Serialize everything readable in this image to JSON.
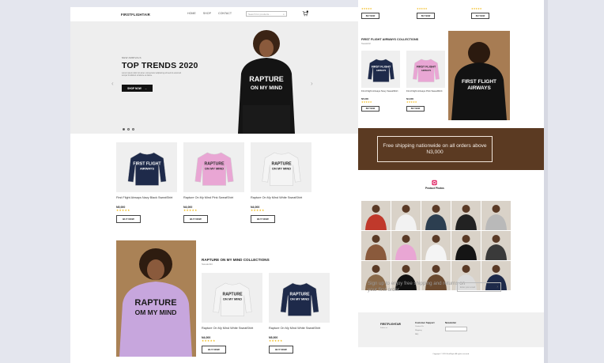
{
  "header": {
    "logo": "FIRSTFLIGHTAIR",
    "nav": [
      "HOME",
      "SHOP",
      "CONTACT"
    ],
    "search_placeholder": "Search for products..."
  },
  "hero": {
    "eyebrow": "NEW ARRIVALS",
    "title": "TOP TRENDS 2020",
    "description": "Lorem ipsum dolor sit amet, consectetur adipiscing elit sed do eiusmod tempor incididunt ut labore et dolore.",
    "button_label": "SHOP NOW",
    "print_line1": "RAPTURE",
    "print_line2": "ON MY MIND"
  },
  "products": [
    {
      "name": "First Flight Airways Navy Black SweatShirt",
      "price": "N5,000",
      "stars": "★★★★★",
      "button": "BUY NOW",
      "color": "#1e2a4a",
      "print": "FIRST FLIGHT\nAIRWAYS",
      "ink": "#ffffff"
    },
    {
      "name": "Rapture On My Mind Pink SweatShirt",
      "price": "N4,000",
      "stars": "★★★★★",
      "button": "BUY NOW",
      "color": "#e9a6d4",
      "print": "RAPTURE\nON MY MIND",
      "ink": "#2a2a2a"
    },
    {
      "name": "Rapture On My Mind White SweatShirt",
      "price": "N4,000",
      "stars": "★★★★★",
      "button": "BUY NOW",
      "color": "#f4f4f4",
      "print": "RAPTURE\nON MY MIND",
      "ink": "#222222"
    }
  ],
  "rapture_collection": {
    "title": "RAPTURE ON MY MIND COLLECTIONS",
    "subtitle": "Sweatshirt",
    "model_print_line1": "RAPTURE",
    "model_print_line2": "OM MY MIND",
    "items": [
      {
        "name": "Rapture On My Mind White SweatShirt",
        "price": "N4,000",
        "stars": "★★★★★",
        "button": "BUY NOW",
        "color": "#f4f4f4",
        "print": "RAPTURE\nON MY MIND",
        "ink": "#222222"
      },
      {
        "name": "Rapture On My Mind White SweatShirt",
        "price": "N5,000",
        "stars": "★★★★★",
        "button": "BUY NOW",
        "color": "#1e2a4a",
        "print": "RAPTURE\nON MY MIND",
        "ink": "#ffffff"
      }
    ]
  },
  "right_top": {
    "stars": "★★★★★",
    "button": "BUY NOW"
  },
  "airways_collection": {
    "title": "FIRST FLIGHT AIRWAYS COLLECTIONS",
    "subtitle": "Sweatshirt",
    "model_print_line1": "FIRST FLIGHT",
    "model_print_line2": "AIRWAYS",
    "items": [
      {
        "name": "First Flight Airways Navy SweatShirt",
        "price": "N5,000",
        "stars": "★★★★★",
        "button": "BUY NOW",
        "color": "#1e2a4a",
        "print": "FIRST FLIGHT\nAIRWAYS",
        "ink": "#ffffff"
      },
      {
        "name": "First Flight Airways Pink SweatShirt",
        "price": "N4,000",
        "stars": "★★★★★",
        "button": "BUY NOW",
        "color": "#e9a6d4",
        "print": "FIRST FLIGHT\nAIRWAYS",
        "ink": "#2a2a2a"
      }
    ]
  },
  "banner": {
    "text": "Free shipping nationwide on all orders above N3,000"
  },
  "instagram": {
    "label": "Product Photos",
    "tiles": [
      "#c0392b",
      "#f2f2f2",
      "#2c3e50",
      "#222222",
      "#b9b9b9",
      "#8a5a3c",
      "#e9a6d4",
      "#f4f4f4",
      "#151515",
      "#3a3a3a",
      "#8a6a4a",
      "#111111",
      "#6b4a2f",
      "#dcdcdc",
      "#1e2a4a"
    ]
  },
  "newsletter": {
    "text": "Sign up to enjoy free shipping and returns on your first order",
    "placeholder": "Enter your email"
  },
  "footer": {
    "logo": "FIRSTFLIGHTAIR",
    "tagline": "Follow us",
    "col1_title": "Customer Support",
    "col1_links": [
      "Contact Us",
      "Shipping",
      "FAQ"
    ],
    "col2_title": "Newsletter",
    "copyright": "Copyright © 2020 FirstFlight. All rights reserved."
  },
  "colors": {
    "accent": "#111111",
    "star": "#f0b400",
    "banner_bg": "#5b3a22",
    "instagram_icon": "#e1306c"
  }
}
